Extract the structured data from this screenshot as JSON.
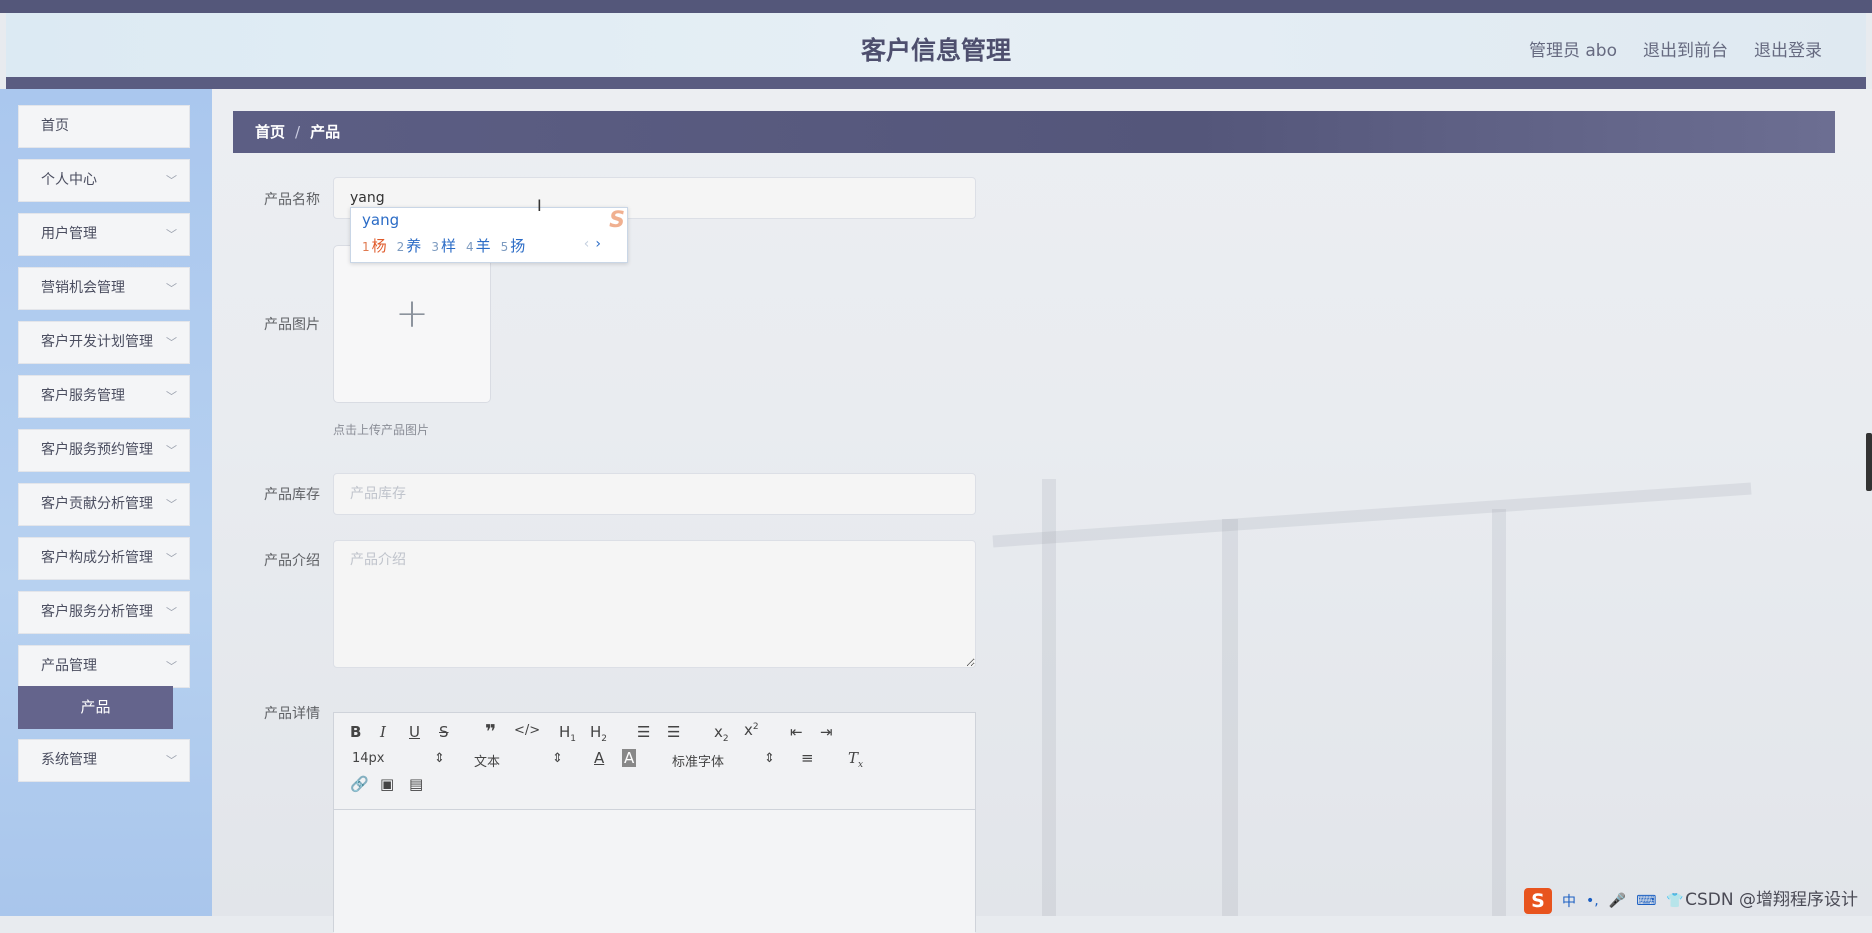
{
  "header": {
    "title": "客户信息管理",
    "nav": [
      "管理员 abo",
      "退出到前台",
      "退出登录"
    ]
  },
  "sidebar": {
    "items": [
      {
        "label": "首页",
        "expandable": false
      },
      {
        "label": "个人中心",
        "expandable": true
      },
      {
        "label": "用户管理",
        "expandable": true
      },
      {
        "label": "营销机会管理",
        "expandable": true
      },
      {
        "label": "客户开发计划管理",
        "expandable": true
      },
      {
        "label": "客户服务管理",
        "expandable": true
      },
      {
        "label": "客户服务预约管理",
        "expandable": true
      },
      {
        "label": "客户贡献分析管理",
        "expandable": true
      },
      {
        "label": "客户构成分析管理",
        "expandable": true
      },
      {
        "label": "客户服务分析管理",
        "expandable": true
      },
      {
        "label": "产品管理",
        "expandable": true
      },
      {
        "label": "系统管理",
        "expandable": true
      }
    ],
    "active_sub": "产品"
  },
  "breadcrumb": {
    "home": "首页",
    "sep": "/",
    "current": "产品"
  },
  "form": {
    "name_label": "产品名称",
    "name_value": "yang",
    "image_label": "产品图片",
    "image_tip": "点击上传产品图片",
    "stock_label": "产品库存",
    "stock_placeholder": "产品库存",
    "intro_label": "产品介绍",
    "intro_placeholder": "产品介绍",
    "detail_label": "产品详情"
  },
  "ime": {
    "composition": "yang",
    "candidates": [
      {
        "n": "1",
        "c": "杨"
      },
      {
        "n": "2",
        "c": "养"
      },
      {
        "n": "3",
        "c": "样"
      },
      {
        "n": "4",
        "c": "羊"
      },
      {
        "n": "5",
        "c": "扬"
      }
    ]
  },
  "editor": {
    "font_size": "14px",
    "block_type": "文本",
    "font_family": "标准字体"
  },
  "watermark": "CSDN @增翔程序设计",
  "tray": {
    "ime_mode": "中"
  }
}
